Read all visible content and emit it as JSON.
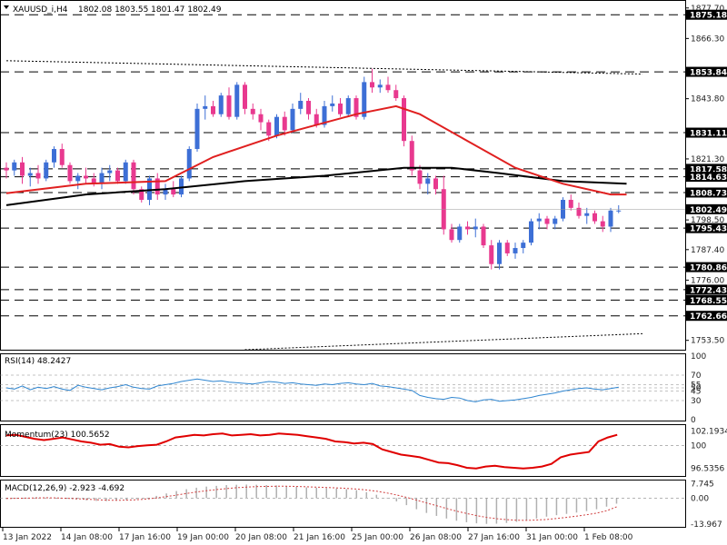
{
  "header": {
    "symbol": "XAUUSD_i,H4",
    "ohlc": "1802.08 1803.55 1801.47 1802.49",
    "collapse_icon": "triangle-down-icon"
  },
  "chart_data": {
    "type": "candlestick",
    "symbol": "XAUUSD_i",
    "timeframe": "H4",
    "colors": {
      "bull": "#3d6fd6",
      "bear": "#e8398f",
      "ma_fast": "#e02020",
      "ma_slow": "#000000",
      "rsi": "#2f86d1",
      "momentum": "#e00000",
      "macd_signal": "#d04040",
      "histogram": "#b0b0b0"
    },
    "price_axis": {
      "ylim": [
        1750,
        1880
      ],
      "tick_labels": [
        "1877.70",
        "1866.30",
        "1843.80",
        "1821.30",
        "1798.50",
        "1787.40",
        "1776.00",
        "1753.50"
      ]
    },
    "current_price": 1802.49,
    "current_price_label": "1802.49",
    "levels": [
      {
        "value": 1875.18,
        "label": "1875.18"
      },
      {
        "value": 1853.84,
        "label": "1853.84"
      },
      {
        "value": 1831.11,
        "label": "1831.11"
      },
      {
        "value": 1817.58,
        "label": "1817.58"
      },
      {
        "value": 1814.63,
        "label": "1814.63"
      },
      {
        "value": 1808.73,
        "label": "1808.73"
      },
      {
        "value": 1795.43,
        "label": "1795.43"
      },
      {
        "value": 1780.86,
        "label": "1780.86"
      },
      {
        "value": 1772.43,
        "label": "1772.43"
      },
      {
        "value": 1768.55,
        "label": "1768.55"
      },
      {
        "value": 1762.66,
        "label": "1762.66"
      }
    ],
    "channel": {
      "upper": [
        [
          0,
          1858
        ],
        [
          80,
          1853
        ]
      ],
      "lower": [
        [
          30,
          1750
        ],
        [
          80,
          1756
        ]
      ]
    },
    "candles": [
      [
        1818,
        1820,
        1814,
        1817
      ],
      [
        1817,
        1821,
        1815,
        1820
      ],
      [
        1820,
        1822,
        1812,
        1815
      ],
      [
        1815,
        1818,
        1811,
        1816
      ],
      [
        1816,
        1819,
        1812,
        1814
      ],
      [
        1814,
        1821,
        1813,
        1820
      ],
      [
        1820,
        1826,
        1818,
        1825
      ],
      [
        1825,
        1827,
        1818,
        1819
      ],
      [
        1819,
        1820,
        1812,
        1813
      ],
      [
        1813,
        1816,
        1810,
        1815
      ],
      [
        1815,
        1818,
        1812,
        1814
      ],
      [
        1814,
        1816,
        1811,
        1812
      ],
      [
        1812,
        1818,
        1810,
        1816
      ],
      [
        1816,
        1819,
        1813,
        1817
      ],
      [
        1817,
        1818,
        1812,
        1813
      ],
      [
        1813,
        1821,
        1812,
        1820
      ],
      [
        1820,
        1821,
        1808,
        1810
      ],
      [
        1810,
        1811,
        1805,
        1806
      ],
      [
        1806,
        1815,
        1804,
        1814
      ],
      [
        1814,
        1816,
        1806,
        1808
      ],
      [
        1808,
        1812,
        1806,
        1810
      ],
      [
        1810,
        1813,
        1807,
        1808
      ],
      [
        1808,
        1815,
        1807,
        1814
      ],
      [
        1814,
        1826,
        1813,
        1825
      ],
      [
        1825,
        1842,
        1824,
        1840
      ],
      [
        1840,
        1845,
        1836,
        1841
      ],
      [
        1841,
        1843,
        1837,
        1838
      ],
      [
        1838,
        1846,
        1837,
        1845
      ],
      [
        1845,
        1848,
        1836,
        1837
      ],
      [
        1837,
        1850,
        1836,
        1849
      ],
      [
        1849,
        1850,
        1838,
        1840
      ],
      [
        1840,
        1842,
        1836,
        1838
      ],
      [
        1838,
        1840,
        1832,
        1835
      ],
      [
        1835,
        1836,
        1828,
        1830
      ],
      [
        1830,
        1838,
        1829,
        1837
      ],
      [
        1837,
        1839,
        1830,
        1832
      ],
      [
        1832,
        1842,
        1831,
        1840
      ],
      [
        1840,
        1846,
        1838,
        1843
      ],
      [
        1843,
        1844,
        1836,
        1838
      ],
      [
        1838,
        1840,
        1833,
        1834
      ],
      [
        1834,
        1843,
        1833,
        1841
      ],
      [
        1841,
        1845,
        1839,
        1842
      ],
      [
        1842,
        1844,
        1837,
        1838
      ],
      [
        1838,
        1845,
        1837,
        1844
      ],
      [
        1844,
        1845,
        1836,
        1837
      ],
      [
        1837,
        1852,
        1836,
        1850
      ],
      [
        1850,
        1855,
        1846,
        1848
      ],
      [
        1848,
        1851,
        1846,
        1849
      ],
      [
        1849,
        1852,
        1846,
        1847
      ],
      [
        1847,
        1849,
        1843,
        1844
      ],
      [
        1844,
        1845,
        1826,
        1828
      ],
      [
        1828,
        1830,
        1815,
        1817
      ],
      [
        1817,
        1819,
        1810,
        1812
      ],
      [
        1812,
        1816,
        1808,
        1814
      ],
      [
        1814,
        1815,
        1808,
        1810
      ],
      [
        1810,
        1815,
        1793,
        1795
      ],
      [
        1795,
        1797,
        1790,
        1791
      ],
      [
        1791,
        1797,
        1790,
        1796
      ],
      [
        1796,
        1798,
        1793,
        1795
      ],
      [
        1795,
        1799,
        1792,
        1796
      ],
      [
        1796,
        1797,
        1788,
        1789
      ],
      [
        1789,
        1791,
        1780,
        1782
      ],
      [
        1782,
        1791,
        1780,
        1790
      ],
      [
        1790,
        1791,
        1785,
        1786
      ],
      [
        1786,
        1790,
        1784,
        1788
      ],
      [
        1788,
        1791,
        1786,
        1790
      ],
      [
        1790,
        1799,
        1789,
        1798
      ],
      [
        1798,
        1801,
        1795,
        1799
      ],
      [
        1799,
        1800,
        1795,
        1797
      ],
      [
        1797,
        1800,
        1795,
        1799
      ],
      [
        1799,
        1807,
        1798,
        1806
      ],
      [
        1806,
        1808,
        1802,
        1803
      ],
      [
        1803,
        1805,
        1799,
        1800
      ],
      [
        1800,
        1803,
        1797,
        1801
      ],
      [
        1801,
        1802,
        1797,
        1798
      ],
      [
        1798,
        1800,
        1794,
        1796
      ],
      [
        1796,
        1803,
        1794,
        1802
      ],
      [
        1802,
        1804,
        1801,
        1802
      ]
    ],
    "ma_fast": [
      [
        0,
        1808.5
      ],
      [
        10,
        1812
      ],
      [
        20,
        1813
      ],
      [
        26,
        1822
      ],
      [
        34,
        1830
      ],
      [
        44,
        1838
      ],
      [
        49,
        1841
      ],
      [
        52,
        1838
      ],
      [
        58,
        1828
      ],
      [
        64,
        1818
      ],
      [
        70,
        1812
      ],
      [
        76,
        1808
      ],
      [
        78,
        1808
      ]
    ],
    "ma_slow": [
      [
        0,
        1804
      ],
      [
        10,
        1808
      ],
      [
        20,
        1810
      ],
      [
        30,
        1813
      ],
      [
        40,
        1815
      ],
      [
        50,
        1818
      ],
      [
        56,
        1818
      ],
      [
        62,
        1816
      ],
      [
        70,
        1813
      ],
      [
        78,
        1812
      ]
    ],
    "rsi": {
      "label": "RSI(14) 48.2427",
      "ylim": [
        0,
        100
      ],
      "levels": [
        70,
        55,
        50,
        45,
        30
      ],
      "tick_labels": [
        "100",
        "70",
        "55",
        "50",
        "45",
        "30",
        "0"
      ],
      "values": [
        50,
        48,
        53,
        47,
        51,
        49,
        52,
        48,
        46,
        54,
        51,
        49,
        47,
        50,
        52,
        55,
        51,
        49,
        48,
        53,
        55,
        57,
        60,
        62,
        64,
        62,
        60,
        61,
        59,
        58,
        57,
        56,
        58,
        60,
        59,
        57,
        58,
        56,
        55,
        54,
        56,
        55,
        57,
        58,
        56,
        55,
        57,
        53,
        52,
        50,
        48,
        46,
        38,
        35,
        33,
        32,
        35,
        34,
        30,
        28,
        31,
        32,
        29,
        30,
        31,
        33,
        35,
        38,
        40,
        42,
        45,
        47,
        49,
        50,
        48,
        47,
        49,
        51
      ]
    },
    "momentum": {
      "label": "Momentum(23) 100.5652",
      "ylim": [
        95.5,
        102.8
      ],
      "level": 100,
      "tick_labels": [
        "102.1934",
        "100",
        "96.5356"
      ],
      "values": [
        101.5,
        101.6,
        101.3,
        101.0,
        100.8,
        101.0,
        101.2,
        100.9,
        100.6,
        100.4,
        100.1,
        100.2,
        99.8,
        99.7,
        99.9,
        100.0,
        100.1,
        100.6,
        101.2,
        101.4,
        101.6,
        101.5,
        101.7,
        101.8,
        101.5,
        101.6,
        101.7,
        101.5,
        101.6,
        101.8,
        101.7,
        101.6,
        101.4,
        101.2,
        101.0,
        100.6,
        100.5,
        100.3,
        100.4,
        100.2,
        99.4,
        99.0,
        98.6,
        98.4,
        98.2,
        97.8,
        97.4,
        97.3,
        97.0,
        96.6,
        96.5,
        96.8,
        96.9,
        96.7,
        96.6,
        96.5,
        96.6,
        96.8,
        97.2,
        98.2,
        98.6,
        98.8,
        99.0,
        100.6,
        101.2,
        101.6
      ]
    },
    "macd": {
      "label": "MACD(12,26,9) -2.923 -4.692",
      "ylim": [
        -15,
        8.5
      ],
      "level": 0,
      "tick_labels": [
        "7.745",
        "0.00",
        "-13.967"
      ],
      "histogram": [
        -0.5,
        -0.3,
        0.2,
        0.5,
        0.3,
        -0.2,
        -0.4,
        -0.8,
        -1.2,
        -1.5,
        -1.6,
        -1.4,
        -1.2,
        -0.6,
        0.2,
        1.2,
        2.5,
        3.8,
        4.8,
        5.6,
        6.2,
        6.6,
        7.0,
        7.2,
        7.3,
        7.2,
        7.0,
        6.8,
        6.5,
        6.1,
        5.8,
        5.6,
        5.4,
        5.2,
        4.8,
        4.3,
        3.2,
        1.8,
        0.2,
        -1.8,
        -3.8,
        -6.0,
        -8.0,
        -9.6,
        -11.0,
        -12.2,
        -13.0,
        -13.6,
        -13.9,
        -13.8,
        -13.4,
        -12.8,
        -12.0,
        -11.0,
        -10.0,
        -9.2,
        -8.5,
        -7.8,
        -7.0,
        -6.0,
        -4.6,
        -3.0
      ],
      "signal": [
        -0.2,
        -0.1,
        0.0,
        0.1,
        0.2,
        0.1,
        -0.1,
        -0.3,
        -0.6,
        -0.9,
        -1.1,
        -1.2,
        -1.1,
        -0.9,
        -0.5,
        0.1,
        0.8,
        1.6,
        2.5,
        3.3,
        4.0,
        4.6,
        5.1,
        5.6,
        5.9,
        6.2,
        6.3,
        6.4,
        6.4,
        6.3,
        6.1,
        5.9,
        5.7,
        5.5,
        5.2,
        4.9,
        4.4,
        3.7,
        2.8,
        1.7,
        0.4,
        -1.1,
        -2.6,
        -4.1,
        -5.6,
        -7.0,
        -8.3,
        -9.4,
        -10.4,
        -11.1,
        -11.6,
        -11.9,
        -12.0,
        -11.8,
        -11.5,
        -11.0,
        -10.4,
        -9.7,
        -9.0,
        -8.1,
        -6.8,
        -4.7
      ]
    },
    "x_tick_labels": [
      "13 Jan 2022",
      "14 Jan 08:00",
      "17 Jan 16:00",
      "19 Jan 00:00",
      "20 Jan 08:00",
      "21 Jan 16:00",
      "25 Jan 00:00",
      "26 Jan 08:00",
      "27 Jan 16:00",
      "31 Jan 00:00",
      "1 Feb 08:00"
    ]
  }
}
